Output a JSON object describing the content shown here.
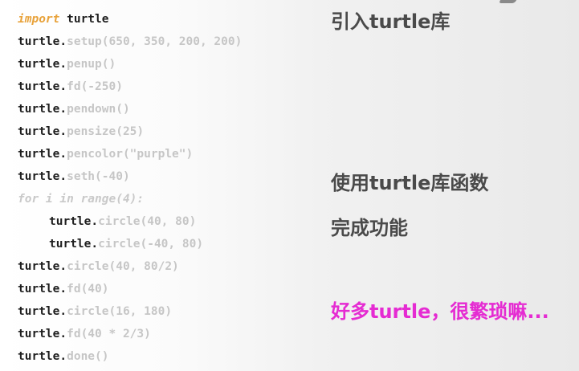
{
  "code": {
    "l1_kw": "import",
    "l1_mod": " turtle",
    "l2_obj": "turtle.",
    "l2_call": "setup(650, 350, 200, 200)",
    "l3_obj": "turtle.",
    "l3_call": "penup()",
    "l4_obj": "turtle.",
    "l4_call": "fd(-250)",
    "l5_obj": "turtle.",
    "l5_call": "pendown()",
    "l6_obj": "turtle.",
    "l6_call": "pensize(25)",
    "l7_obj": "turtle.",
    "l7_call": "pencolor(\"purple\")",
    "l8_obj": "turtle.",
    "l8_call": "seth(-40)",
    "l9_loop": "for i in range(4):",
    "l10_obj": "turtle.",
    "l10_call": "circle(40, 80)",
    "l11_obj": "turtle.",
    "l11_call": "circle(-40, 80)",
    "l12_obj": "turtle.",
    "l12_call": "circle(40, 80/2)",
    "l13_obj": "turtle.",
    "l13_call": "fd(40)",
    "l14_obj": "turtle.",
    "l14_call": "circle(16, 180)",
    "l15_obj": "turtle.",
    "l15_call": "fd(40 * 2/3)",
    "l16_obj": "turtle.",
    "l16_call": "done()"
  },
  "notes": {
    "import_lib": "引入turtle库",
    "use_funcs": "使用turtle库函数",
    "complete": "完成功能",
    "exclaim": "好多turtle，很繁琐嘛..."
  },
  "colors": {
    "keyword": "#e8a23a",
    "highlight": "#e52bd2",
    "note_text": "#4a4a4a"
  }
}
